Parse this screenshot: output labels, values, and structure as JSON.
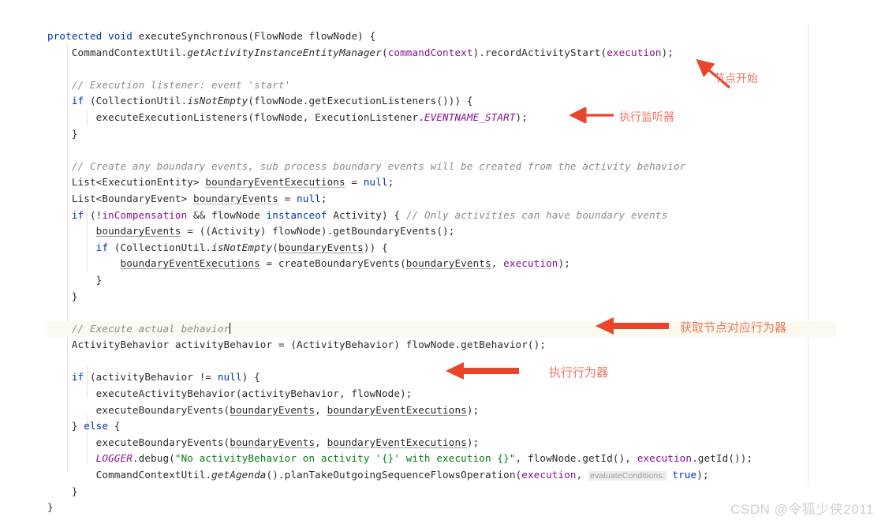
{
  "editor": {
    "language": "Java",
    "background_color": "#ffffff",
    "current_line_highlight_color": "#fbfaef",
    "margin_guide_color": "#e6e6e6",
    "caret_line_index": 14,
    "colors": {
      "keyword": "#0033b3",
      "comment": "#8c8c8c",
      "string": "#067d17",
      "field_or_param": "#871094",
      "static_field": "#871094",
      "plain_text": "#2b2b2b",
      "annotation_accent": "#ef7561",
      "annotation_arrow": "#e8452a",
      "watermark": "#d0d0d0"
    },
    "lines": [
      "protected void executeSynchronous(FlowNode flowNode) {",
      "    CommandContextUtil.getActivityInstanceEntityManager(commandContext).recordActivityStart(execution);",
      "",
      "    // Execution listener: event 'start'",
      "    if (CollectionUtil.isNotEmpty(flowNode.getExecutionListeners())) {",
      "        executeExecutionListeners(flowNode, ExecutionListener.EVENTNAME_START);",
      "    }",
      "",
      "    // Create any boundary events, sub process boundary events will be created from the activity behavior",
      "    List<ExecutionEntity> boundaryEventExecutions = null;",
      "    List<BoundaryEvent> boundaryEvents = null;",
      "    if (!inCompensation && flowNode instanceof Activity) { // Only activities can have boundary events",
      "        boundaryEvents = ((Activity) flowNode).getBoundaryEvents();",
      "        if (CollectionUtil.isNotEmpty(boundaryEvents)) {",
      "            boundaryEventExecutions = createBoundaryEvents(boundaryEvents, execution);",
      "        }",
      "    }",
      "",
      "    // Execute actual behavior",
      "    ActivityBehavior activityBehavior = (ActivityBehavior) flowNode.getBehavior();",
      "",
      "    if (activityBehavior != null) {",
      "        executeActivityBehavior(activityBehavior, flowNode);",
      "        executeBoundaryEvents(boundaryEvents, boundaryEventExecutions);",
      "    } else {",
      "        executeBoundaryEvents(boundaryEvents, boundaryEventExecutions);",
      "        LOGGER.debug(\"No activityBehavior on activity '{}' with execution {}\", flowNode.getId(), execution.getId());",
      "        CommandContextUtil.getAgenda().planTakeOutgoingSequenceFlowsOperation(execution, evaluateConditions: true);",
      "    }",
      "}"
    ],
    "inline_hints": [
      {
        "label": "evaluateConditions:",
        "line": 26
      }
    ]
  },
  "annotations": [
    {
      "id": "anno-node-start",
      "text": "节点开始",
      "arrow": "arrow-up-left-diagonal"
    },
    {
      "id": "anno-exec-listener",
      "text": "执行监听器",
      "arrow": "arrow-left"
    },
    {
      "id": "anno-get-behavior",
      "text": "获取节点对应行为器",
      "arrow": "arrow-left"
    },
    {
      "id": "anno-exec-behavior",
      "text": "执行行为器",
      "arrow": "arrow-left"
    }
  ],
  "watermark": {
    "text": "CSDN @令狐少侠2011"
  }
}
